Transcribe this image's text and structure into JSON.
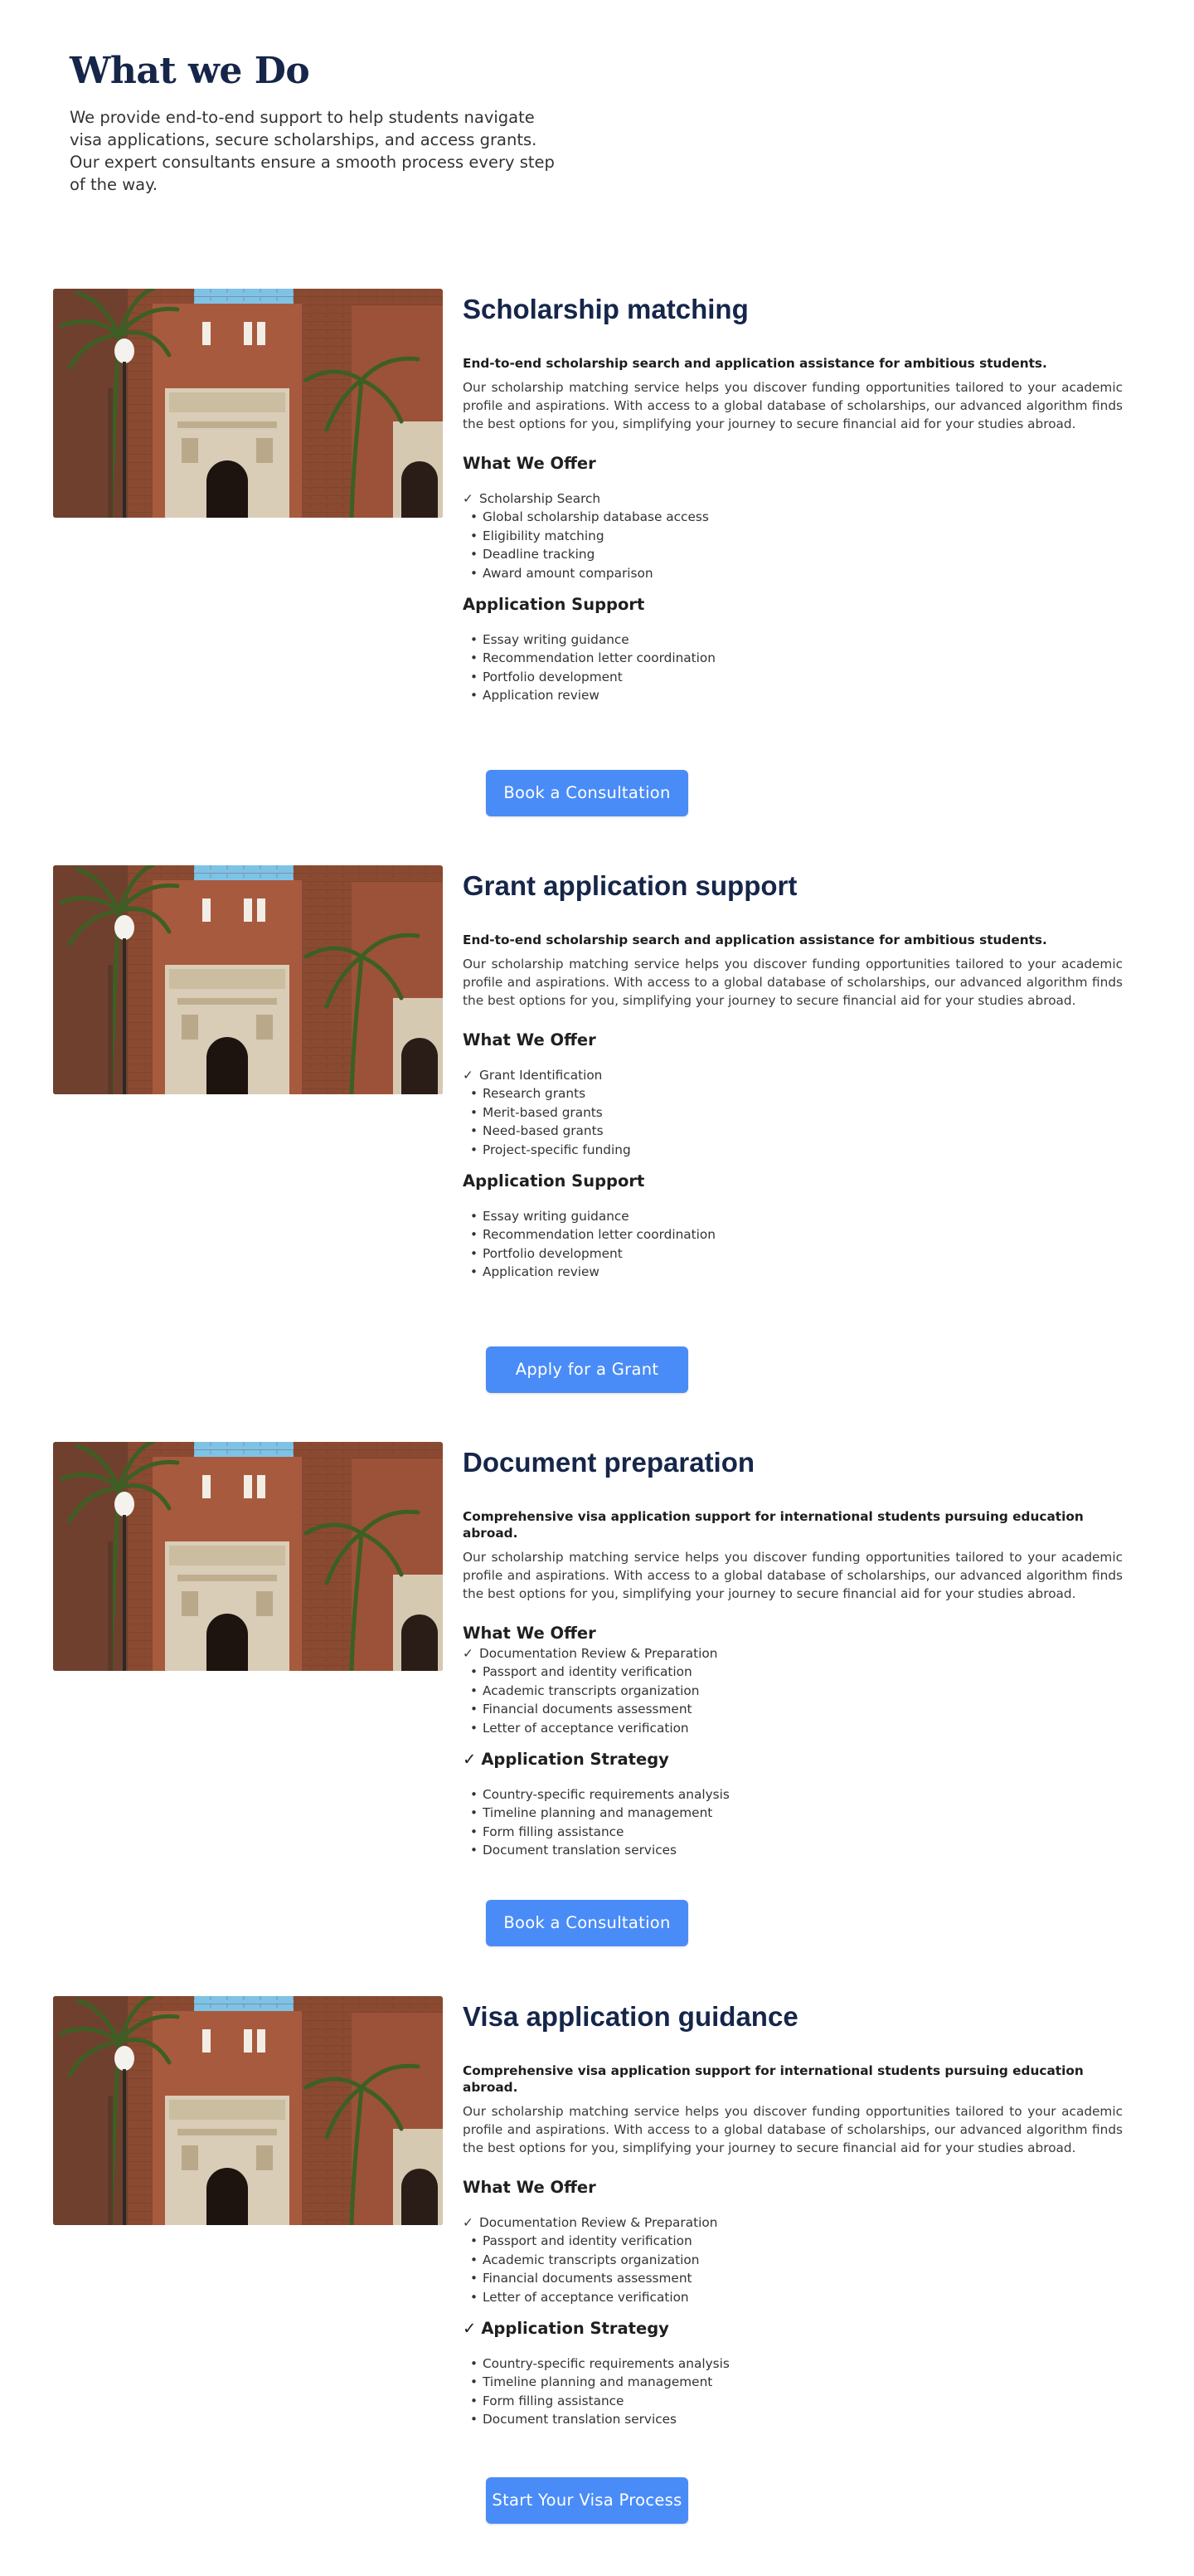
{
  "hero": {
    "title": "What we Do",
    "subtitle": "We provide end-to-end support to help students navigate visa applications, secure scholarships, and access grants. Our expert consultants ensure a smooth process every step of the way."
  },
  "colors": {
    "heading": "#16264a",
    "button": "#4a8cf7"
  },
  "services": [
    {
      "title": "Scholarship matching",
      "lead": "End-to-end scholarship search and application assistance for ambitious students.",
      "desc": "Our scholarship matching service helps you discover funding opportunities tailored to your academic profile and aspirations. With access to a global database of scholarships, our advanced algorithm finds the best options for you, simplifying your journey to secure financial aid for your studies abroad.",
      "offer_title": "What We Offer",
      "offer_items": [
        "Scholarship Search",
        "Global scholarship database access",
        "Eligibility matching",
        "Deadline tracking",
        "Award amount comparison"
      ],
      "support_title": "Application Support",
      "support_items": [
        "Essay writing guidance",
        "Recommendation letter coordination",
        "Portfolio development",
        "Application review"
      ],
      "button": "Book a Consultation"
    },
    {
      "title": "Grant application support",
      "lead": "End-to-end scholarship search and application assistance for ambitious students.",
      "desc": "Our scholarship matching service helps you discover funding opportunities tailored to your academic profile and aspirations. With access to a global database of scholarships, our advanced algorithm finds the best options for you, simplifying your journey to secure financial aid for your studies abroad.",
      "offer_title": "What We Offer",
      "offer_items": [
        "Grant Identification",
        "Research grants",
        "Merit-based grants",
        "Need-based grants",
        "Project-specific funding"
      ],
      "support_title": "Application Support",
      "support_items": [
        "Essay writing guidance",
        "Recommendation letter coordination",
        "Portfolio development",
        "Application review"
      ],
      "button": "Apply for a Grant"
    },
    {
      "title": "Document preparation",
      "lead": "Comprehensive visa application support for international students pursuing education abroad.",
      "desc": "Our scholarship matching service helps you discover funding opportunities tailored to your academic profile and aspirations. With access to a global database of scholarships, our advanced algorithm finds the best options for you, simplifying your journey to secure financial aid for your studies abroad.",
      "offer_title": "What We Offer",
      "offer_items": [
        "Documentation Review & Preparation",
        "Passport and identity verification",
        "Academic transcripts organization",
        "Financial documents assessment",
        "Letter of acceptance verification"
      ],
      "support_title": "Application Strategy",
      "support_items": [
        "Country-specific requirements analysis",
        "Timeline planning and management",
        "Form filling assistance",
        "Document translation services"
      ],
      "button": "Book a Consultation"
    },
    {
      "title": "Visa application guidance",
      "lead": "Comprehensive visa application support for international students pursuing education abroad.",
      "desc": "Our scholarship matching service helps you discover funding opportunities tailored to your academic profile and aspirations. With access to a global database of scholarships, our advanced algorithm finds the best options for you, simplifying your journey to secure financial aid for your studies abroad.",
      "offer_title": "What We Offer",
      "offer_items": [
        "Documentation Review & Preparation",
        "Passport and identity verification",
        "Academic transcripts organization",
        "Financial documents assessment",
        "Letter of acceptance verification"
      ],
      "support_title": "Application Strategy",
      "support_items": [
        "Country-specific requirements analysis",
        "Timeline planning and management",
        "Form filling assistance",
        "Document translation services"
      ],
      "button": "Start Your Visa Process"
    }
  ]
}
